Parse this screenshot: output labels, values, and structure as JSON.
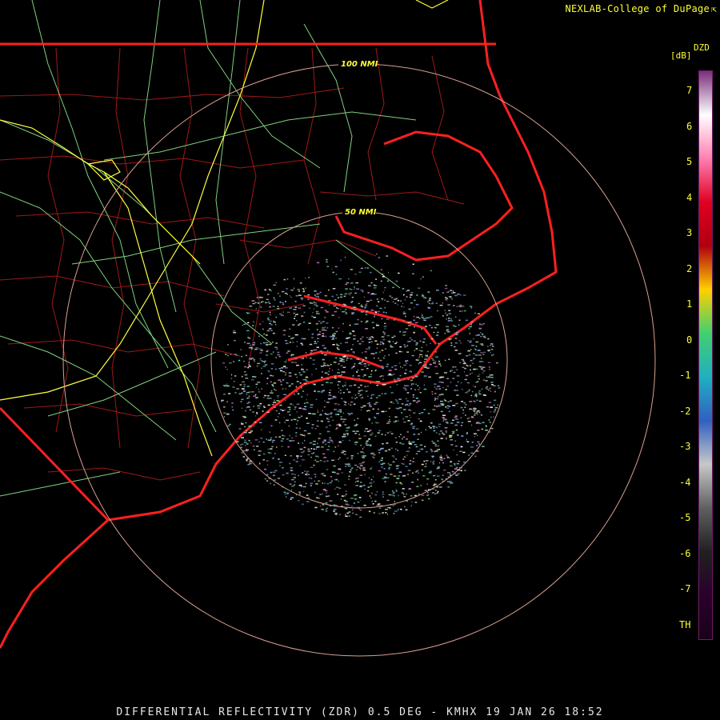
{
  "credit": {
    "text": "NEXLAB-College of DuPage",
    "mark": "⇱"
  },
  "footer": {
    "text": "DIFFERENTIAL REFLECTIVITY (ZDR) 0.5 DEG - KMHX 19 JAN 26 18:52"
  },
  "legend": {
    "product": "DZD",
    "units": "[dB]",
    "ticks": [
      "7",
      "6",
      "5",
      "4",
      "3",
      "2",
      "1",
      "0",
      "-1",
      "-2",
      "-3",
      "-4",
      "-5",
      "-6",
      "-7",
      "TH"
    ],
    "color_stops": [
      "#7a2d7a",
      "#ffffff",
      "#ff7fb0",
      "#e00020",
      "#b00010",
      "#ffd000",
      "#40d070",
      "#20b0c0",
      "#3060c0",
      "#c8c8c8",
      "#606060",
      "#202020",
      "#2a002a",
      "#1a001a"
    ]
  },
  "range_rings": {
    "inner_label": "50 NMI",
    "outer_label": "100 NMI"
  },
  "colors": {
    "state_borders": "#ff2020",
    "county_lines": "#b01818",
    "highways": "#80d080",
    "interstates": "#ffff40",
    "range_rings": "#d8a090",
    "ring_labels": "#ffff33"
  }
}
